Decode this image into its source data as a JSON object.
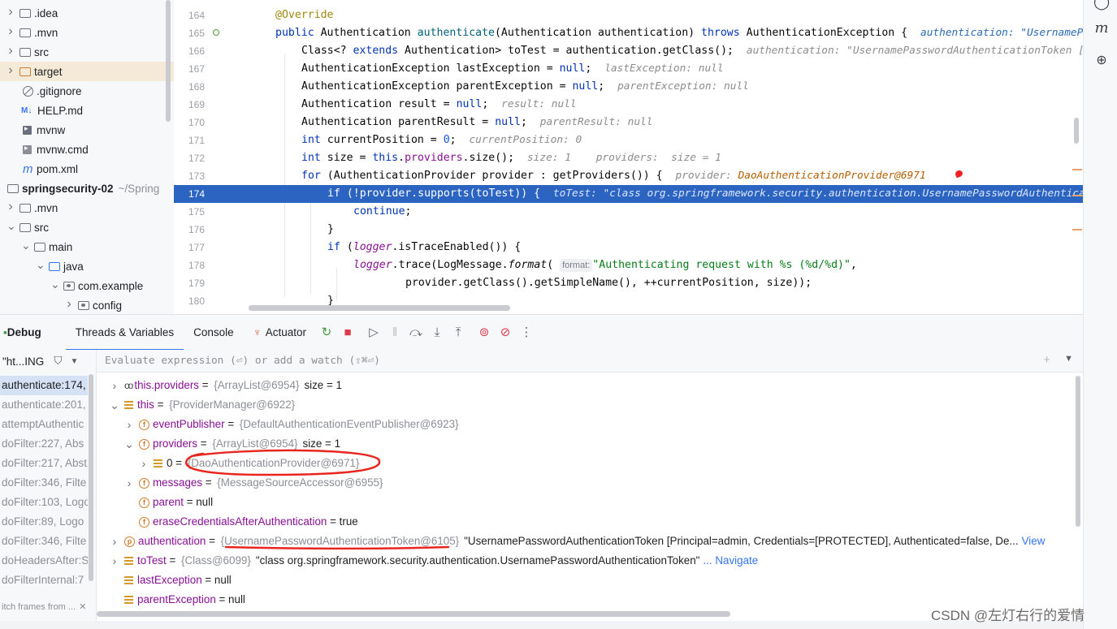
{
  "project_tree": {
    "items": [
      {
        "label": ".idea",
        "kind": "folder",
        "chevron": "right"
      },
      {
        "label": ".mvn",
        "kind": "folder",
        "chevron": "right"
      },
      {
        "label": "src",
        "kind": "folder",
        "chevron": "right"
      },
      {
        "label": "target",
        "kind": "folder-orange",
        "chevron": "right",
        "selected": true
      },
      {
        "label": ".gitignore",
        "kind": "ignore"
      },
      {
        "label": "HELP.md",
        "kind": "markdown",
        "badge": "M↓"
      },
      {
        "label": "mvnw",
        "kind": "shell"
      },
      {
        "label": "mvnw.cmd",
        "kind": "text"
      },
      {
        "label": "pom.xml",
        "kind": "maven",
        "badge": "m"
      },
      {
        "label": "springsecurity-02",
        "kind": "module",
        "suffix": "~/Spring"
      },
      {
        "label": ".mvn",
        "kind": "folder",
        "chevron": "right"
      },
      {
        "label": "src",
        "kind": "folder",
        "chevron": "down"
      },
      {
        "label": "main",
        "kind": "folder",
        "chevron": "down"
      },
      {
        "label": "java",
        "kind": "folder-blue",
        "chevron": "down"
      },
      {
        "label": "com.example",
        "kind": "package",
        "chevron": "down"
      },
      {
        "label": "config",
        "kind": "package",
        "chevron": "right"
      }
    ]
  },
  "editor": {
    "line_numbers": [
      "164",
      "165",
      "166",
      "167",
      "168",
      "169",
      "170",
      "171",
      "172",
      "173",
      "174",
      "175",
      "176",
      "177",
      "178",
      "179",
      "180"
    ],
    "current_line": "174",
    "code": {
      "l164": "@Override",
      "l165_kw": "public",
      "l165_type": " Authentication ",
      "l165_fn": "authenticate",
      "l165_rest": "(Authentication authentication) ",
      "l165_kw2": "throws",
      "l165_rest2": " AuthenticationException {  ",
      "l165_hint": "authentication: \"UsernamePasswordAuthenticationToken [Principal=admin, Credentials=[PROTECTED]",
      "l166_a": "Class<? ",
      "l166_kw": "extends",
      "l166_b": " Authentication> toTest = authentication.getClass();  ",
      "l166_hint": "authentication: \"UsernamePasswordAuthenticationToken [Principal=admin]\"",
      "l167_a": "AuthenticationException lastException = ",
      "l167_kw": "null",
      "l167_hint": "lastException: null",
      "l168_a": "AuthenticationException parentException = ",
      "l168_kw": "null",
      "l168_hint": "parentException: null",
      "l169_a": "Authentication result = ",
      "l169_kw": "null",
      "l169_hint": "result: null",
      "l170_a": "Authentication parentResult = ",
      "l170_kw": "null",
      "l170_hint": "parentResult: null",
      "l171_kw": "int",
      "l171_a": " currentPosition = ",
      "l171_num": "0",
      "l171_hint": "currentPosition: 0",
      "l172_kw": "int",
      "l172_a": " size = ",
      "l172_kw2": "this",
      "l172_fld": "providers",
      "l172_b": ".size();",
      "l172_hint": "size: 1    providers:  size = 1",
      "l173_kw": "for",
      "l173_a": " (AuthenticationProvider provider : getProviders()) {  ",
      "l173_hint_a": "provider: ",
      "l173_hint_b": "DaoAuthenticationProvider@6971",
      "l174_kw": "if",
      "l174_a": " (!provider.supports(toTest)) {  ",
      "l174_hint": "toTest: \"class org.springframework.security.authentication.UsernamePasswordAuthenticationToken\"",
      "l175_kw": "continue",
      "l176": "}",
      "l177_kw": "if",
      "l177_a": " (",
      "l177_fld": "logger",
      "l177_b": ".isTraceEnabled()) {",
      "l178_fld": "logger",
      "l178_a": ".trace(LogMessage.",
      "l178_fn": "format",
      "l178_tag": "format:",
      "l178_str": "\"Authenticating request with %s (%d/%d)\"",
      "l178_b": ",",
      "l179": "provider.getClass().getSimpleName(), ++currentPosition, size));",
      "l180": "}"
    }
  },
  "debug": {
    "title": "Debug",
    "tabs": [
      "Threads & Variables",
      "Console",
      "Actuator"
    ],
    "active_tab": "Threads & Variables",
    "thread_selector": "\"ht...ING",
    "evaluate_placeholder": "Evaluate expression (⏎) or add a watch (⇧⌘⏎)",
    "frames": [
      "authenticate:174,",
      "authenticate:201,",
      "attemptAuthentic",
      "doFilter:227, Abs",
      "doFilter:217, Abst",
      "doFilter:346, Filte",
      "doFilter:103, Logo",
      "doFilter:89, Logo",
      "doFilter:346, Filte",
      "doHeadersAfter:S",
      "doFilterInternal:7"
    ],
    "frames_footer": "itch frames from ...",
    "variables": [
      {
        "name": "this.providers",
        "type": "{ArrayList@6954}",
        "value": "size = 1"
      },
      {
        "name": "this",
        "type": "{ProviderManager@6922}",
        "value": ""
      },
      {
        "name": "eventPublisher",
        "type": "{DefaultAuthenticationEventPublisher@6923}",
        "value": ""
      },
      {
        "name": "providers",
        "type": "{ArrayList@6954}",
        "value": "size = 1"
      },
      {
        "name": "0",
        "type": "{DaoAuthenticationProvider@6971}",
        "value": ""
      },
      {
        "name": "messages",
        "type": "{MessageSourceAccessor@6955}",
        "value": ""
      },
      {
        "name": "parent",
        "type": "",
        "value": "null"
      },
      {
        "name": "eraseCredentialsAfterAuthentication",
        "type": "",
        "value": "true"
      },
      {
        "name": "authentication",
        "type": "{UsernamePasswordAuthenticationToken@6105}",
        "value": "\"UsernamePasswordAuthenticationToken [Principal=admin, Credentials=[PROTECTED], Authenticated=false, De...",
        "link": "View"
      },
      {
        "name": "toTest",
        "type": "{Class@6099}",
        "value": "\"class org.springframework.security.authentication.UsernamePasswordAuthenticationToken\"",
        "link": "... Navigate"
      },
      {
        "name": "lastException",
        "type": "",
        "value": "null"
      },
      {
        "name": "parentException",
        "type": "",
        "value": "null"
      }
    ]
  },
  "watermark": "CSDN @左灯右行的爱情",
  "colors": {
    "selection_blue": "#2c64c2",
    "annotation_red": "#e8261f",
    "accent": "#3574f0"
  }
}
